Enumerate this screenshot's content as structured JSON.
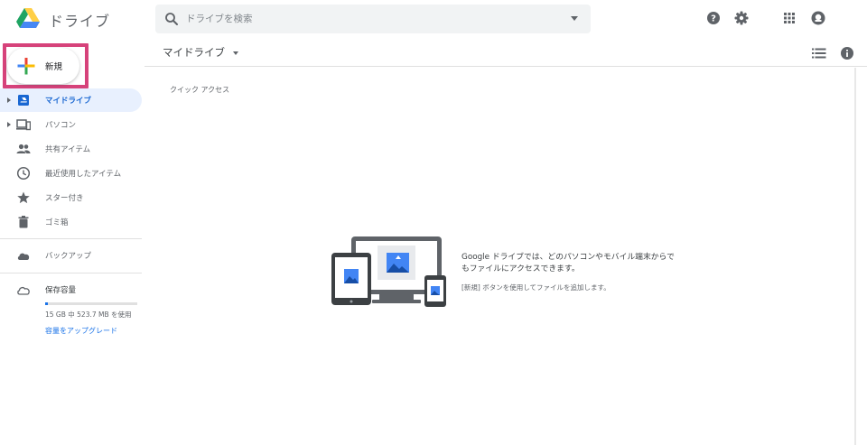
{
  "app": {
    "title": "ドライブ"
  },
  "search": {
    "placeholder": "ドライブを検索"
  },
  "header_icons": [
    "help-icon",
    "settings-icon",
    "apps-grid-icon",
    "account-icon"
  ],
  "sidebar": {
    "new_label": "新規",
    "items": [
      {
        "label": "マイドライブ",
        "icon": "my-drive-icon",
        "active": true,
        "expandable": true
      },
      {
        "label": "パソコン",
        "icon": "computers-icon",
        "active": false,
        "expandable": true
      },
      {
        "label": "共有アイテム",
        "icon": "shared-people-icon",
        "active": false,
        "expandable": false
      },
      {
        "label": "最近使用したアイテム",
        "icon": "clock-icon",
        "active": false,
        "expandable": false
      },
      {
        "label": "スター付き",
        "icon": "star-icon",
        "active": false,
        "expandable": false
      },
      {
        "label": "ゴミ箱",
        "icon": "trash-icon",
        "active": false,
        "expandable": false
      }
    ],
    "backup_label": "バックアップ",
    "storage_label": "保存容量",
    "storage_usage": "15 GB 中 523.7 MB を使用",
    "storage_fraction": 0.034,
    "upgrade_label": "容量をアップグレード"
  },
  "main": {
    "title": "マイドライブ",
    "quick_access": "クイック アクセス",
    "empty_state": {
      "title": "Google ドライブでは、どのパソコンやモバイル端末からでもファイルにアクセスできます。",
      "hint": "[新規] ボタンを使用してファイルを追加します。"
    }
  },
  "colors": {
    "accent": "#1a73e8",
    "active_bg": "#e8f0fe",
    "highlight_box": "#d6427a"
  }
}
